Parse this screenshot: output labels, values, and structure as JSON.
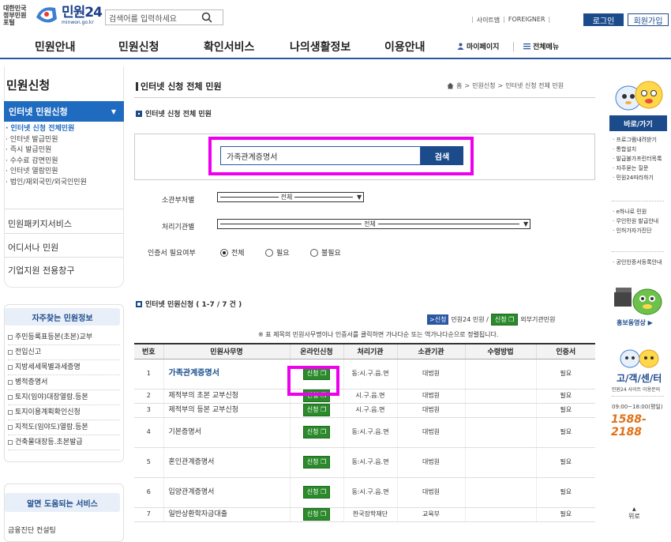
{
  "header": {
    "gov_label": "대한민국 정부민원포털",
    "brand": "민원24",
    "brand_sub": "minwon.go.kr",
    "search_placeholder": "검색어를 입력하세요",
    "sitemap": "사이트맵",
    "foreigner": "FOREIGNER",
    "login": "로그인",
    "join": "회원가입"
  },
  "gnb": {
    "items": [
      "민원안내",
      "민원신청",
      "확인서비스",
      "나의생활정보",
      "이용안내"
    ],
    "mypage": "마이페이지",
    "allmenu": "전체메뉴"
  },
  "lnb": {
    "title": "민원신청",
    "active": "인터넷 민원신청",
    "sub": [
      "· 인터넷 신청 전체민원",
      "· 인터넷 발급민원",
      "· 즉시 발급민원",
      "· 수수료 감면민원",
      "· 인터넷 열람민원",
      "· 법인/재외국민/외국인민원"
    ],
    "items": [
      "민원패키지서비스",
      "어디서나 민원",
      "기업지원 전용창구"
    ]
  },
  "fav": {
    "title": "자주찾는 민원정보",
    "items": [
      "주민등록표등본(초본)교부",
      "전입신고",
      "지방세세목별과세증명",
      "병적증명서",
      "토지(임야)대장열람.등본",
      "토지이용계획확인신청",
      "지적도(임야도)열람.등본",
      "건축물대장등.초본발급"
    ]
  },
  "help": {
    "title": "알면 도움되는 서비스",
    "item": "금융진단 컨설팅"
  },
  "main": {
    "page_title": "인터넷 신청 전체 민원",
    "crumb_home": "홈",
    "crumb_1": "민원신청",
    "crumb_2": "인터넷 신청 전체 민원",
    "crumb_sep": ">",
    "section_title": "인터넷 신청 전체 민원",
    "search_value": "가족관계증명서",
    "search_btn": "검색",
    "dept_label": "소관부처별",
    "dept_value": "전체",
    "org_label": "처리기관별",
    "org_value": "전체",
    "cert_label": "인증서 필요여부",
    "radio": [
      "전체",
      "필요",
      "불필요"
    ],
    "result_title": "인터넷 민원신청 ( 1-7 / 7 건 )",
    "legend_tag1": ">신청",
    "legend_text1": "민원24 민원 /",
    "legend_tag2": "신청",
    "legend_text2": "외부기관민원",
    "note": "※ 표 제목의 민원사무명이나 인증서를 클릭하면 가나다순 또는 역가나다순으로 정렬됩니다."
  },
  "table": {
    "headers": [
      "번호",
      "민원사무명",
      "온라인신청",
      "처리기관",
      "소관기관",
      "수령방법",
      "인증서"
    ],
    "apply_label": "신청",
    "rows": [
      {
        "no": "1",
        "name": "가족관계증명서",
        "org": "동:시.구.읍.면",
        "dept": "대법원",
        "cert": "필요"
      },
      {
        "no": "2",
        "name": "제적부의 초본 교부신청",
        "org": "시.구.읍.면",
        "dept": "대법원",
        "cert": "필요"
      },
      {
        "no": "3",
        "name": "제적부의 등본 교부신청",
        "org": "시.구.읍.면",
        "dept": "대법원",
        "cert": "필요"
      },
      {
        "no": "4",
        "name": "기본증명서",
        "org": "동:시.구.읍.면",
        "dept": "대법원",
        "cert": "필요"
      },
      {
        "no": "5",
        "name": "혼인관계증명서",
        "org": "동:시.구.읍.면",
        "dept": "대법원",
        "cert": "필요"
      },
      {
        "no": "6",
        "name": "입양관계증명서",
        "org": "동:시.구.읍.면",
        "dept": "대법원",
        "cert": "필요"
      },
      {
        "no": "7",
        "name": "일반상환학자금대출",
        "org": "한국장학재단",
        "dept": "교육부",
        "cert": "필요"
      }
    ]
  },
  "quick": {
    "head": "바로/가기",
    "list1": [
      "· 프로그램내려받기",
      "· 통합설치",
      "· 발급불가프린터목록",
      "· 자주묻는 질문",
      "· 민원24따라하기"
    ],
    "list2": [
      "· e하나로 민원",
      "· 무인민원 발급안내",
      "· 인허가자가진단"
    ],
    "list3": [
      "· 공인인증서등록안내"
    ],
    "promo": "홍보동영상",
    "cs_title": "고/객/센/터",
    "cs_sub": "민원24 사이트 이용문의",
    "cs_hours": "09:00~18:00(평일)",
    "cs_phone": "1588-2188",
    "top": "위로"
  },
  "colors": {
    "primary": "#1c4b8c",
    "accent": "#1f6bc0",
    "apply_green": "#2b8a2b",
    "highlight": "#ee00ee"
  }
}
